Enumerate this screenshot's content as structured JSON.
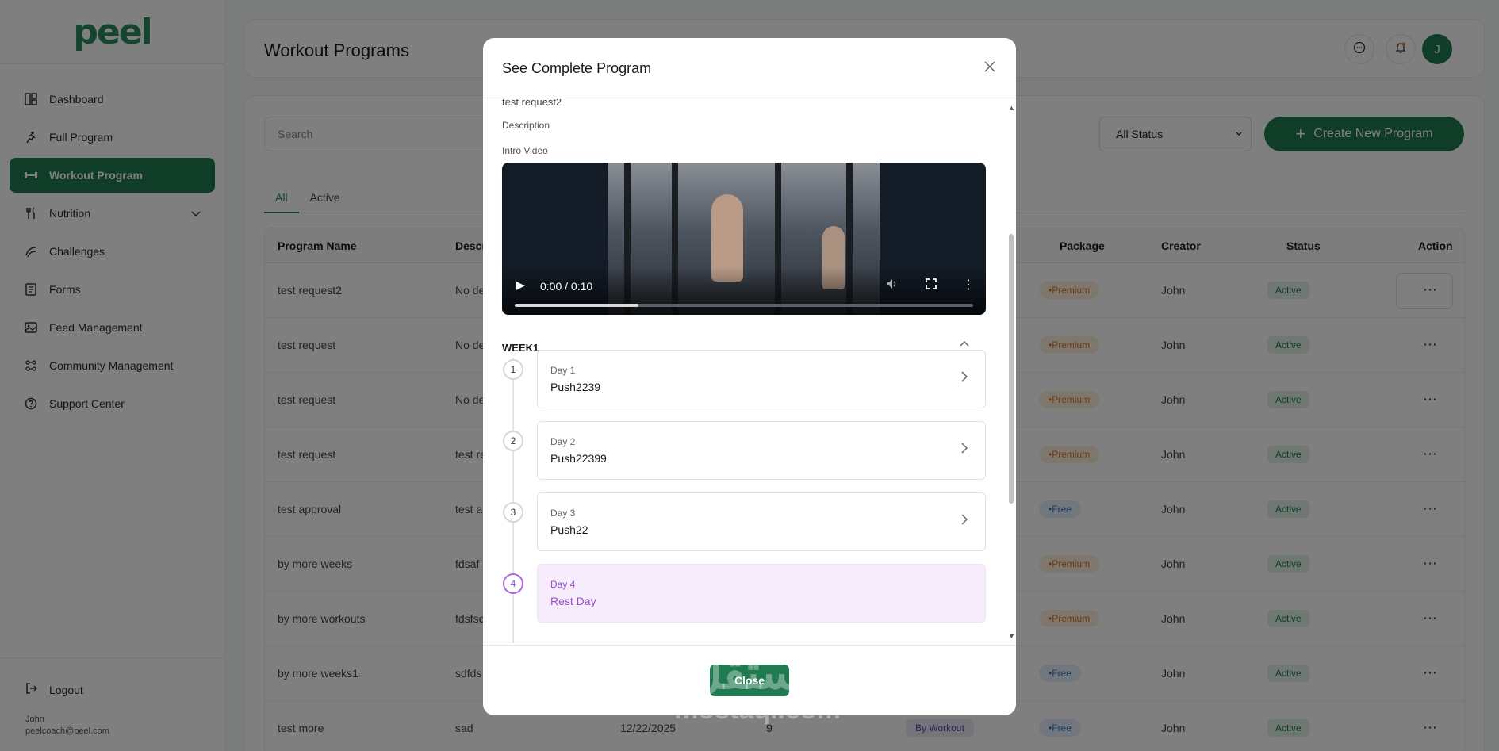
{
  "brand": {
    "logo": "peel",
    "color": "#2d8a5e",
    "accent": "#1f7a50"
  },
  "sidebar": {
    "items": [
      {
        "label": "Dashboard",
        "icon": "dashboard-icon"
      },
      {
        "label": "Full Program",
        "icon": "running-icon"
      },
      {
        "label": "Workout Program",
        "icon": "dumbbell-icon",
        "active": true
      },
      {
        "label": "Nutrition",
        "icon": "utensils-icon",
        "has_submenu": true
      },
      {
        "label": "Challenges",
        "icon": "challenge-icon"
      },
      {
        "label": "Forms",
        "icon": "form-icon"
      },
      {
        "label": "Feed Management",
        "icon": "feed-icon"
      },
      {
        "label": "Community Management",
        "icon": "community-icon"
      },
      {
        "label": "Support Center",
        "icon": "help-icon"
      }
    ],
    "logout_label": "Logout",
    "user_name": "John",
    "user_email": "peelcoach@peel.com"
  },
  "header": {
    "title": "Workout Programs",
    "avatar_initial": "J"
  },
  "toolbar": {
    "search_placeholder": "Search",
    "status_filter": "All Status",
    "create_label": "Create New Program"
  },
  "tabs": [
    {
      "label": "All",
      "active": true
    },
    {
      "label": "Active",
      "active": false
    }
  ],
  "table": {
    "columns": {
      "program_name": "Program Name",
      "description": "Descr",
      "package": "Package",
      "creator": "Creator",
      "status": "Status",
      "action": "Action"
    },
    "rows": [
      {
        "name": "test request2",
        "desc": "No de",
        "package": "Premium",
        "creator": "John",
        "status": "Active"
      },
      {
        "name": "test request",
        "desc": "No de",
        "package": "Premium",
        "creator": "John",
        "status": "Active"
      },
      {
        "name": "test request",
        "desc": "No de",
        "package": "Premium",
        "creator": "John",
        "status": "Active"
      },
      {
        "name": "test request",
        "desc": "test re",
        "package": "Premium",
        "creator": "John",
        "status": "Active"
      },
      {
        "name": "test approval",
        "desc": "test a",
        "package": "Free",
        "creator": "John",
        "status": "Active"
      },
      {
        "name": "by more weeks",
        "desc": "fdsaf",
        "package": "Premium",
        "creator": "John",
        "status": "Active"
      },
      {
        "name": "by more workouts",
        "desc": "fdsfsc",
        "package": "Premium",
        "creator": "John",
        "status": "Active"
      },
      {
        "name": "by more weeks1",
        "desc": "sdfds",
        "package": "Free",
        "creator": "John",
        "status": "Active"
      },
      {
        "name": "test more",
        "desc": "sad",
        "date": "12/22/2025",
        "count": "9",
        "type": "By Workout",
        "package": "Free",
        "creator": "John",
        "status": "Active"
      }
    ],
    "action_glyph": "⋯"
  },
  "modal": {
    "title": "See Complete Program",
    "cut_text": "test request2",
    "description_label": "Description",
    "intro_video_label": "Intro Video",
    "video": {
      "time": "0:00 / 0:10",
      "progress": 0.27
    },
    "week_label": "WEEK1",
    "days": [
      {
        "num": "1",
        "label": "Day 1",
        "name": "Push2239",
        "rest": false
      },
      {
        "num": "2",
        "label": "Day 2",
        "name": "Push22399",
        "rest": false
      },
      {
        "num": "3",
        "label": "Day 3",
        "name": "Push22",
        "rest": false
      },
      {
        "num": "4",
        "label": "Day 4",
        "name": "Rest Day",
        "rest": true
      }
    ],
    "close_label": "Close"
  },
  "watermark": {
    "arabic": "مستقل",
    "latin": "mostaql.com"
  }
}
